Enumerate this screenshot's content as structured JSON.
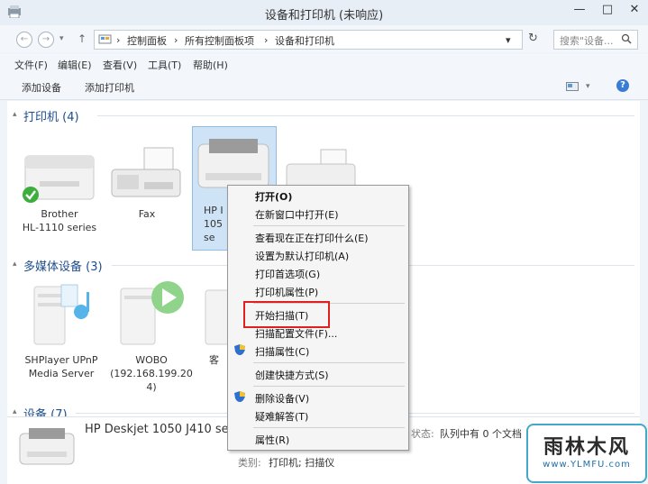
{
  "window": {
    "title": "设备和打印机 (未响应)",
    "minimize": "—",
    "maximize": "□",
    "close": "✕"
  },
  "address": {
    "crumbs": [
      "控制面板",
      "所有控制面板项",
      "设备和打印机"
    ],
    "search_placeholder": "搜索\"设备...",
    "search_icon": "search-icon"
  },
  "menubar": [
    "文件(F)",
    "编辑(E)",
    "查看(V)",
    "工具(T)",
    "帮助(H)"
  ],
  "toolbar": {
    "add_device": "添加设备",
    "add_printer": "添加打印机"
  },
  "sections": {
    "printers": {
      "title": "打印机 (4)"
    },
    "media": {
      "title": "多媒体设备 (3)"
    },
    "devices": {
      "title": "设备 (7)"
    }
  },
  "printers": [
    {
      "line1": "Brother",
      "line2": "HL-1110 series",
      "line3": ""
    },
    {
      "line1": "Fax",
      "line2": "",
      "line3": ""
    },
    {
      "line1": "HP I",
      "line2": "105",
      "line3": "se"
    },
    {
      "line1": "",
      "line2": "",
      "line3": ""
    }
  ],
  "media": [
    {
      "line1": "SHPlayer UPnP",
      "line2": "Media Server",
      "line3": ""
    },
    {
      "line1": "WOBO",
      "line2": "(192.168.199.20",
      "line3": "4)"
    },
    {
      "line1": "客",
      "line2": "",
      "line3": ""
    }
  ],
  "context_menu": {
    "open": "打开(O)",
    "open_new_window": "在新窗口中打开(E)",
    "see_printing": "查看现在正在打印什么(E)",
    "set_default": "设置为默认打印机(A)",
    "print_prefs": "打印首选项(G)",
    "printer_props": "打印机属性(P)",
    "start_scan": "开始扫描(T)",
    "scan_profiles": "扫描配置文件(F)...",
    "scan_props": "扫描属性(C)",
    "create_shortcut": "创建快捷方式(S)",
    "remove_device": "删除设备(V)",
    "troubleshoot": "疑难解答(T)",
    "properties": "属性(R)"
  },
  "status": {
    "device_name": "HP Deskjet 1050 J410 series",
    "status_label": "状态:",
    "status_value": "队列中有 0 个文档",
    "category_label": "类别:",
    "category_value": "打印机; 扫描仪"
  },
  "watermark": {
    "brand": "雨林木风",
    "url": "www.YLMFU.com"
  },
  "colors": {
    "highlight_box": "#e0201f",
    "section_header": "#1e4e8c",
    "selection": "#cfe3f7"
  }
}
